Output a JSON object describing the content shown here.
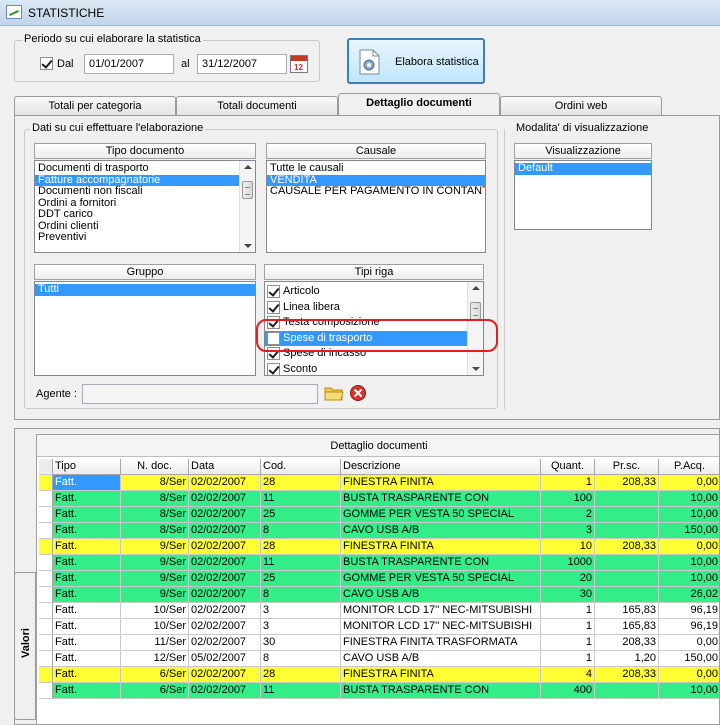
{
  "window": {
    "title": "STATISTICHE"
  },
  "period": {
    "group_label": "Periodo su cui elaborare la statistica",
    "dal_label": "Dal",
    "dal_checked": true,
    "date_from": "01/01/2007",
    "al_label": "al",
    "date_to": "31/12/2007",
    "calendar_icon": "calendar-icon"
  },
  "elabora_button": "Elabora statistica",
  "tabs": [
    "Totali per categoria",
    "Totali documenti",
    "Dettaglio documenti",
    "Ordini web"
  ],
  "active_tab": "Dettaglio documenti",
  "filters": {
    "group_label": "Dati su cui effettuare l'elaborazione",
    "tipo_documento": {
      "header": "Tipo documento",
      "items": [
        "Documenti di trasporto",
        "Fatture accompagnatorie",
        "Documenti non fiscali",
        "Ordini a fornitori",
        "DDT carico",
        "Ordini clienti",
        "Preventivi"
      ],
      "selected": "Fatture accompagnatorie"
    },
    "causale": {
      "header": "Causale",
      "items": [
        "Tutte le causali",
        "VENDITA",
        "CAUSALE PER PAGAMENTO IN CONTANT"
      ],
      "selected": "VENDITA"
    },
    "gruppo": {
      "header": "Gruppo",
      "items": [
        "Tutti"
      ],
      "selected": "Tutti"
    },
    "tipi_riga": {
      "header": "Tipi riga",
      "items": [
        {
          "label": "Articolo",
          "checked": true
        },
        {
          "label": "Linea libera",
          "checked": true
        },
        {
          "label": "Testa composizione",
          "checked": true
        },
        {
          "label": "Spese di trasporto",
          "checked": false
        },
        {
          "label": "Spese di incasso",
          "checked": true
        },
        {
          "label": "Sconto",
          "checked": true
        }
      ],
      "selected": "Spese di trasporto"
    },
    "agente_label": "Agente :",
    "agente_value": ""
  },
  "visualizzazione": {
    "group_label": "Modalita' di visualizzazione",
    "header": "Visualizzazione",
    "items": [
      "Default"
    ],
    "selected": "Default"
  },
  "grid": {
    "side_tab": "Valori",
    "title": "Dettaglio documenti",
    "columns": [
      "Tipo",
      "N. doc.",
      "Data",
      "Cod.",
      "Descrizione",
      "Quant.",
      "Pr.sc.",
      "P.Acq."
    ],
    "colors": {
      "yellow": "#ffff33",
      "green": "#33ee88",
      "white": "#ffffff"
    },
    "rows": [
      {
        "tipo": "Fatt.",
        "ndoc": "8/Ser",
        "data": "02/02/2007",
        "cod": "28",
        "desc": "FINESTRA FINITA",
        "quant": "1",
        "prsc": "208,33",
        "pacq": "0,00",
        "color": "yellow"
      },
      {
        "tipo": "Fatt.",
        "ndoc": "8/Ser",
        "data": "02/02/2007",
        "cod": "11",
        "desc": "BUSTA TRASPARENTE CON",
        "quant": "100",
        "prsc": "",
        "pacq": "10,00",
        "color": "green"
      },
      {
        "tipo": "Fatt.",
        "ndoc": "8/Ser",
        "data": "02/02/2007",
        "cod": "25",
        "desc": "GOMME PER VESTA 50 SPECIAL",
        "quant": "2",
        "prsc": "",
        "pacq": "10,00",
        "color": "green"
      },
      {
        "tipo": "Fatt.",
        "ndoc": "8/Ser",
        "data": "02/02/2007",
        "cod": "8",
        "desc": "CAVO USB A/B",
        "quant": "3",
        "prsc": "",
        "pacq": "150,00",
        "color": "green"
      },
      {
        "tipo": "Fatt.",
        "ndoc": "9/Ser",
        "data": "02/02/2007",
        "cod": "28",
        "desc": "FINESTRA FINITA",
        "quant": "10",
        "prsc": "208,33",
        "pacq": "0,00",
        "color": "yellow"
      },
      {
        "tipo": "Fatt.",
        "ndoc": "9/Ser",
        "data": "02/02/2007",
        "cod": "11",
        "desc": "BUSTA TRASPARENTE CON",
        "quant": "1000",
        "prsc": "",
        "pacq": "10,00",
        "color": "green"
      },
      {
        "tipo": "Fatt.",
        "ndoc": "9/Ser",
        "data": "02/02/2007",
        "cod": "25",
        "desc": "GOMME PER VESTA 50 SPECIAL",
        "quant": "20",
        "prsc": "",
        "pacq": "10,00",
        "color": "green"
      },
      {
        "tipo": "Fatt.",
        "ndoc": "9/Ser",
        "data": "02/02/2007",
        "cod": "8",
        "desc": "CAVO USB A/B",
        "quant": "30",
        "prsc": "",
        "pacq": "26,02",
        "color": "green"
      },
      {
        "tipo": "Fatt.",
        "ndoc": "10/Ser",
        "data": "02/02/2007",
        "cod": "3",
        "desc": "MONITOR LCD 17'' NEC-MITSUBISHI",
        "quant": "1",
        "prsc": "165,83",
        "pacq": "96,19",
        "color": "white"
      },
      {
        "tipo": "Fatt.",
        "ndoc": "10/Ser",
        "data": "02/02/2007",
        "cod": "3",
        "desc": "MONITOR LCD 17'' NEC-MITSUBISHI",
        "quant": "1",
        "prsc": "165,83",
        "pacq": "96,19",
        "color": "white"
      },
      {
        "tipo": "Fatt.",
        "ndoc": "11/Ser",
        "data": "02/02/2007",
        "cod": "30",
        "desc": "FINESTRA FINITA TRASFORMATA",
        "quant": "1",
        "prsc": "208,33",
        "pacq": "0,00",
        "color": "white"
      },
      {
        "tipo": "Fatt.",
        "ndoc": "12/Ser",
        "data": "05/02/2007",
        "cod": "8",
        "desc": "CAVO USB A/B",
        "quant": "1",
        "prsc": "1,20",
        "pacq": "150,00",
        "color": "white"
      },
      {
        "tipo": "Fatt.",
        "ndoc": "6/Ser",
        "data": "02/02/2007",
        "cod": "28",
        "desc": "FINESTRA FINITA",
        "quant": "4",
        "prsc": "208,33",
        "pacq": "0,00",
        "color": "yellow"
      },
      {
        "tipo": "Fatt.",
        "ndoc": "6/Ser",
        "data": "02/02/2007",
        "cod": "11",
        "desc": "BUSTA TRASPARENTE CON",
        "quant": "400",
        "prsc": "",
        "pacq": "10,00",
        "color": "green"
      }
    ]
  },
  "icons": {
    "folder": "folder-icon",
    "clear": "clear-icon",
    "app": "stats-app-icon",
    "elabora": "gear-document-icon"
  }
}
